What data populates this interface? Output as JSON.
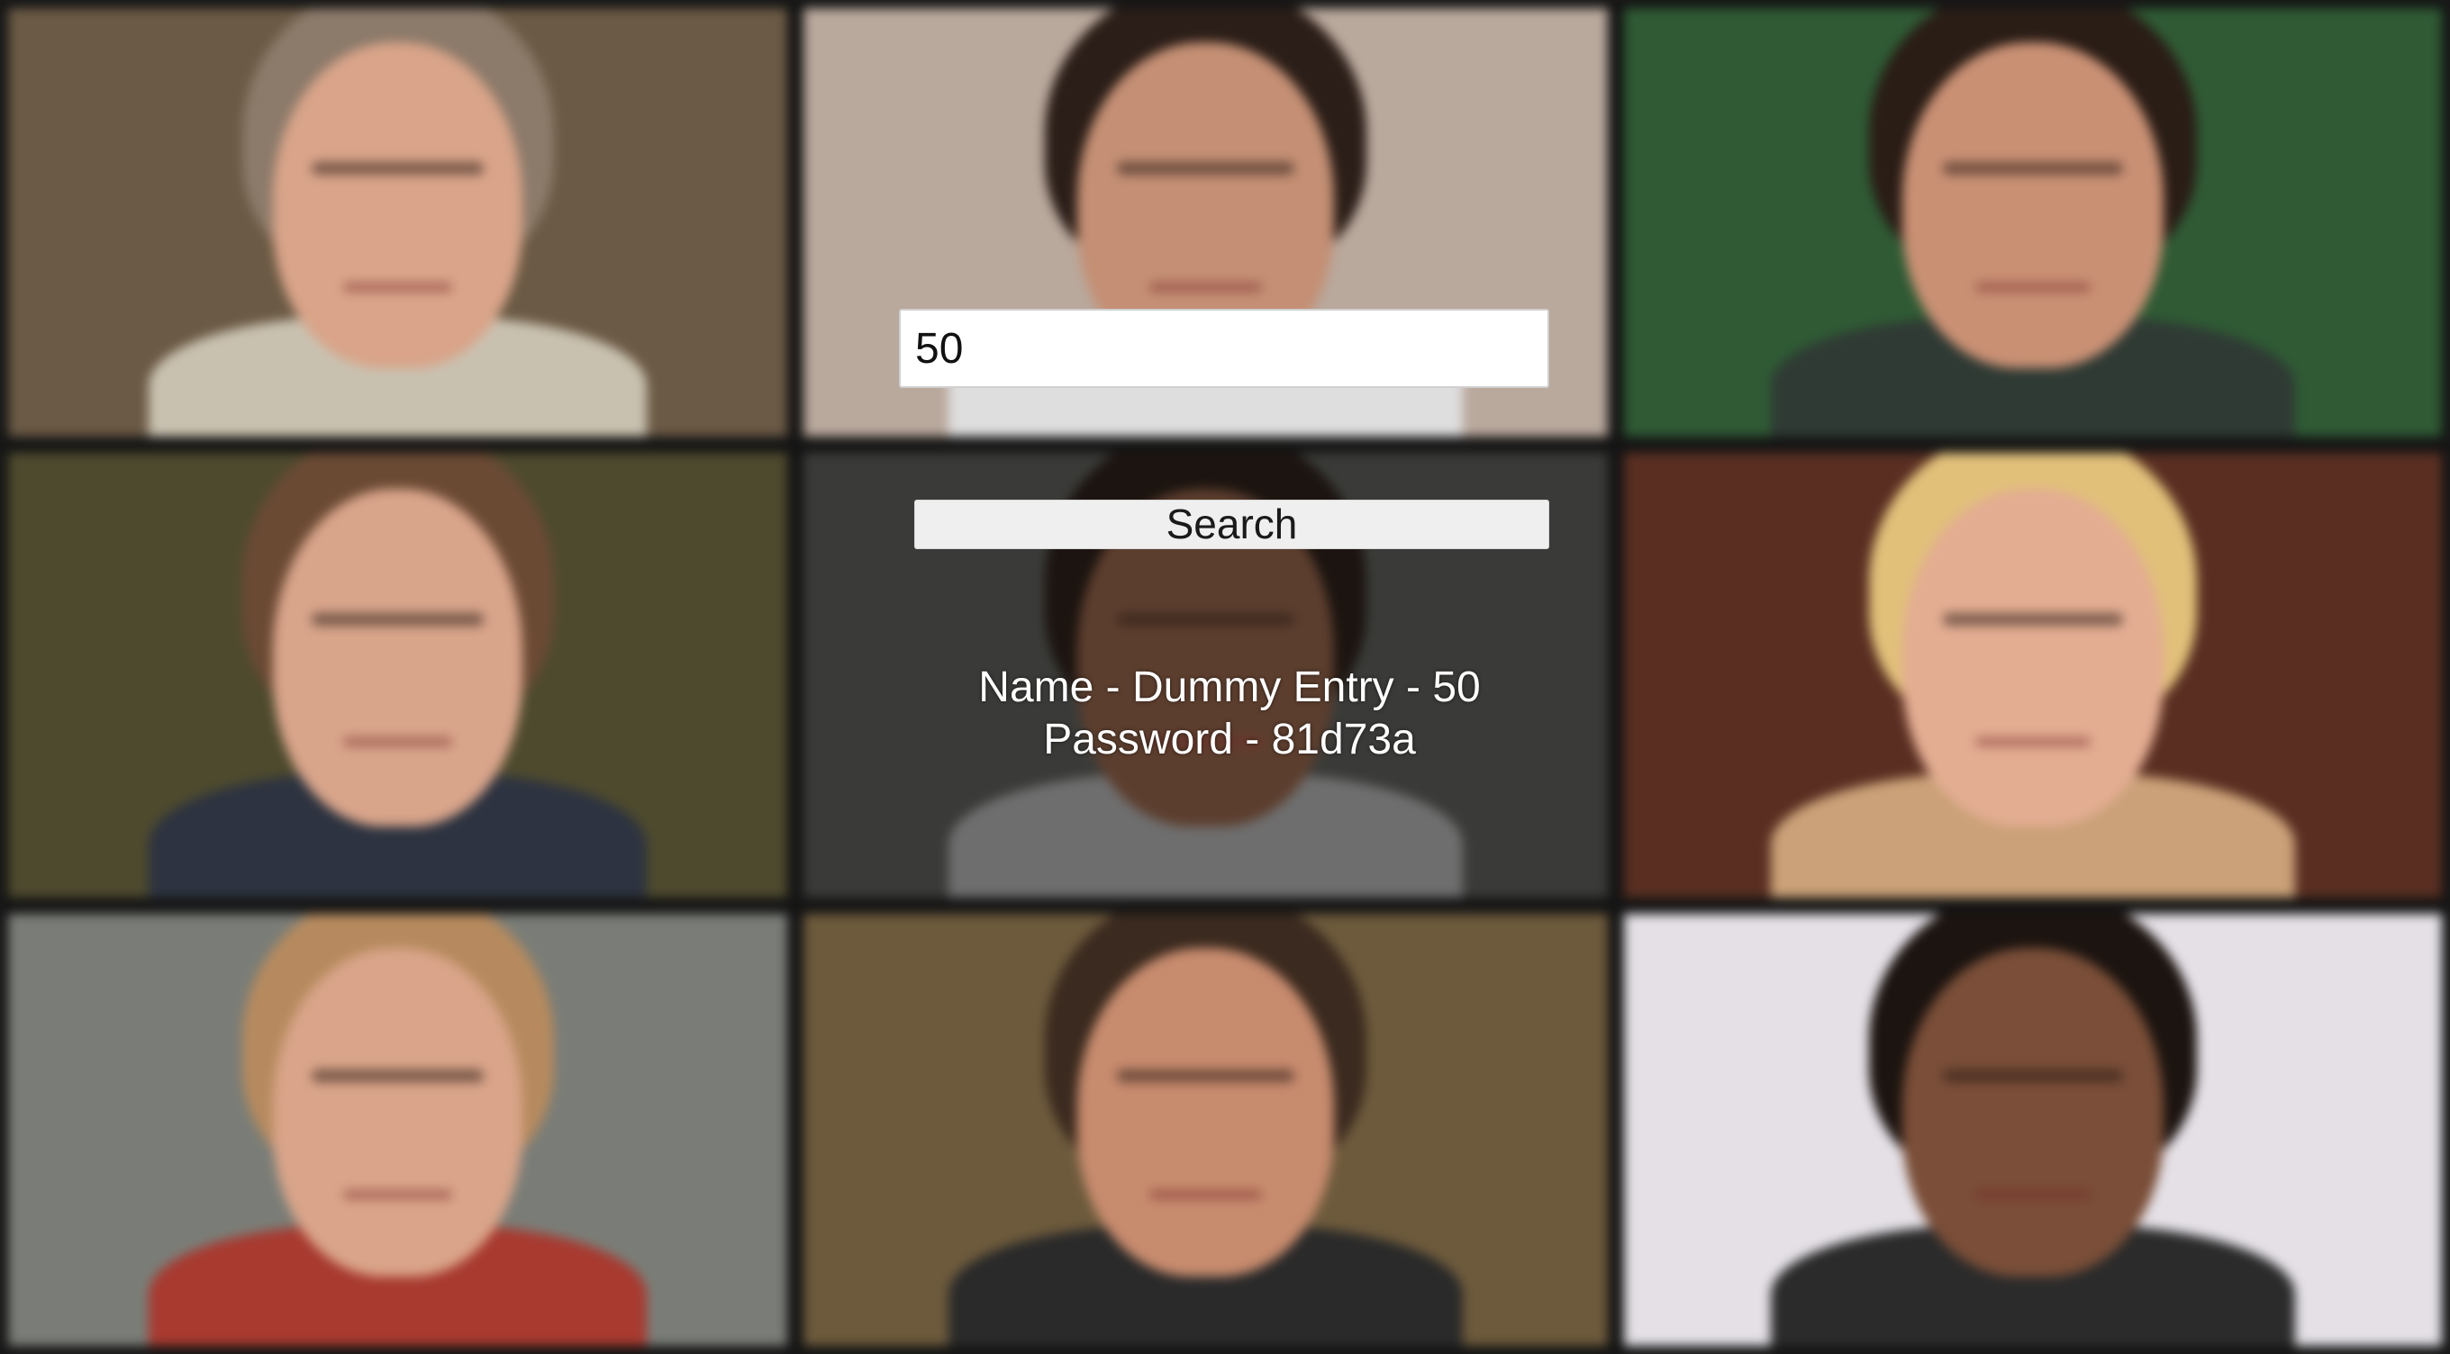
{
  "search": {
    "value": "50",
    "button_label": "Search"
  },
  "result": {
    "name_line": "Name - Dummy Entry - 50",
    "password_line": "Password - 81d73a"
  },
  "background": {
    "tiles": [
      {
        "name": "video-tile-1",
        "bg": "#6b5a45",
        "skin": "#d9a489",
        "hair": "#8c7a6a",
        "body": "#e8e2d8",
        "cloth": "#c9c1b0"
      },
      {
        "name": "video-tile-2",
        "bg": "#b9a89c",
        "skin": "#c48f74",
        "hair": "#2b1e18",
        "body": "#e6e6e6",
        "cloth": "#dedede"
      },
      {
        "name": "video-tile-3",
        "bg": "#2f5a34",
        "skin": "#c99074",
        "hair": "#2a1d16",
        "body": "#3a4a3a",
        "cloth": "#2f3a34"
      },
      {
        "name": "video-tile-4",
        "bg": "#4e4a2e",
        "skin": "#d8a48a",
        "hair": "#6b4a34",
        "body": "#2d3340",
        "cloth": "#2d3340"
      },
      {
        "name": "video-tile-5",
        "bg": "#3a3b38",
        "skin": "#5c3e2e",
        "hair": "#1c1410",
        "body": "#7a7a7a",
        "cloth": "#6e6e6e"
      },
      {
        "name": "video-tile-6",
        "bg": "#5a2f22",
        "skin": "#e3ad92",
        "hair": "#e1c07a",
        "body": "#d7b48a",
        "cloth": "#caa178"
      },
      {
        "name": "video-tile-7",
        "bg": "#7a7d77",
        "skin": "#d9a489",
        "hair": "#b68a5e",
        "body": "#a83a30",
        "cloth": "#a83a30"
      },
      {
        "name": "video-tile-8",
        "bg": "#6d5a3c",
        "skin": "#c78b6e",
        "hair": "#3b2a1f",
        "body": "#2a2a2a",
        "cloth": "#2a2a2a"
      },
      {
        "name": "video-tile-9",
        "bg": "#e4e0e6",
        "skin": "#7a4e38",
        "hair": "#1c1410",
        "body": "#2b2b2b",
        "cloth": "#2b2b2b"
      }
    ]
  }
}
